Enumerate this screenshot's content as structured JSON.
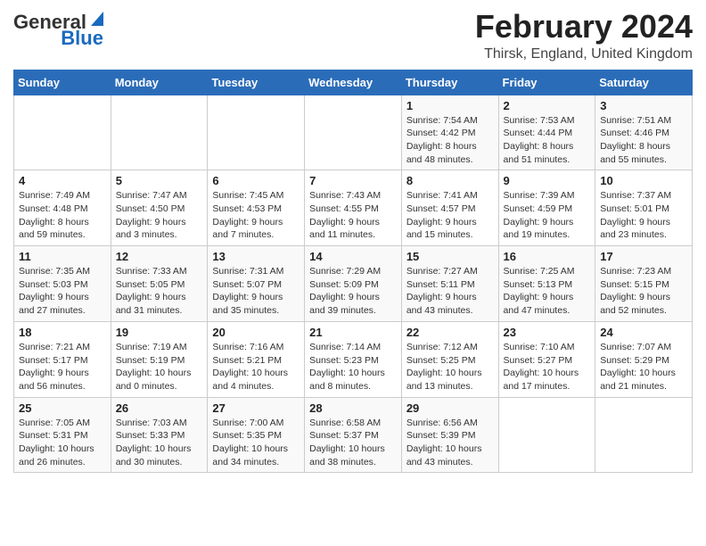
{
  "logo": {
    "line1": "General",
    "line2": "Blue"
  },
  "title": "February 2024",
  "subtitle": "Thirsk, England, United Kingdom",
  "days_of_week": [
    "Sunday",
    "Monday",
    "Tuesday",
    "Wednesday",
    "Thursday",
    "Friday",
    "Saturday"
  ],
  "weeks": [
    [
      {
        "day": "",
        "info": ""
      },
      {
        "day": "",
        "info": ""
      },
      {
        "day": "",
        "info": ""
      },
      {
        "day": "",
        "info": ""
      },
      {
        "day": "1",
        "info": "Sunrise: 7:54 AM\nSunset: 4:42 PM\nDaylight: 8 hours\nand 48 minutes."
      },
      {
        "day": "2",
        "info": "Sunrise: 7:53 AM\nSunset: 4:44 PM\nDaylight: 8 hours\nand 51 minutes."
      },
      {
        "day": "3",
        "info": "Sunrise: 7:51 AM\nSunset: 4:46 PM\nDaylight: 8 hours\nand 55 minutes."
      }
    ],
    [
      {
        "day": "4",
        "info": "Sunrise: 7:49 AM\nSunset: 4:48 PM\nDaylight: 8 hours\nand 59 minutes."
      },
      {
        "day": "5",
        "info": "Sunrise: 7:47 AM\nSunset: 4:50 PM\nDaylight: 9 hours\nand 3 minutes."
      },
      {
        "day": "6",
        "info": "Sunrise: 7:45 AM\nSunset: 4:53 PM\nDaylight: 9 hours\nand 7 minutes."
      },
      {
        "day": "7",
        "info": "Sunrise: 7:43 AM\nSunset: 4:55 PM\nDaylight: 9 hours\nand 11 minutes."
      },
      {
        "day": "8",
        "info": "Sunrise: 7:41 AM\nSunset: 4:57 PM\nDaylight: 9 hours\nand 15 minutes."
      },
      {
        "day": "9",
        "info": "Sunrise: 7:39 AM\nSunset: 4:59 PM\nDaylight: 9 hours\nand 19 minutes."
      },
      {
        "day": "10",
        "info": "Sunrise: 7:37 AM\nSunset: 5:01 PM\nDaylight: 9 hours\nand 23 minutes."
      }
    ],
    [
      {
        "day": "11",
        "info": "Sunrise: 7:35 AM\nSunset: 5:03 PM\nDaylight: 9 hours\nand 27 minutes."
      },
      {
        "day": "12",
        "info": "Sunrise: 7:33 AM\nSunset: 5:05 PM\nDaylight: 9 hours\nand 31 minutes."
      },
      {
        "day": "13",
        "info": "Sunrise: 7:31 AM\nSunset: 5:07 PM\nDaylight: 9 hours\nand 35 minutes."
      },
      {
        "day": "14",
        "info": "Sunrise: 7:29 AM\nSunset: 5:09 PM\nDaylight: 9 hours\nand 39 minutes."
      },
      {
        "day": "15",
        "info": "Sunrise: 7:27 AM\nSunset: 5:11 PM\nDaylight: 9 hours\nand 43 minutes."
      },
      {
        "day": "16",
        "info": "Sunrise: 7:25 AM\nSunset: 5:13 PM\nDaylight: 9 hours\nand 47 minutes."
      },
      {
        "day": "17",
        "info": "Sunrise: 7:23 AM\nSunset: 5:15 PM\nDaylight: 9 hours\nand 52 minutes."
      }
    ],
    [
      {
        "day": "18",
        "info": "Sunrise: 7:21 AM\nSunset: 5:17 PM\nDaylight: 9 hours\nand 56 minutes."
      },
      {
        "day": "19",
        "info": "Sunrise: 7:19 AM\nSunset: 5:19 PM\nDaylight: 10 hours\nand 0 minutes."
      },
      {
        "day": "20",
        "info": "Sunrise: 7:16 AM\nSunset: 5:21 PM\nDaylight: 10 hours\nand 4 minutes."
      },
      {
        "day": "21",
        "info": "Sunrise: 7:14 AM\nSunset: 5:23 PM\nDaylight: 10 hours\nand 8 minutes."
      },
      {
        "day": "22",
        "info": "Sunrise: 7:12 AM\nSunset: 5:25 PM\nDaylight: 10 hours\nand 13 minutes."
      },
      {
        "day": "23",
        "info": "Sunrise: 7:10 AM\nSunset: 5:27 PM\nDaylight: 10 hours\nand 17 minutes."
      },
      {
        "day": "24",
        "info": "Sunrise: 7:07 AM\nSunset: 5:29 PM\nDaylight: 10 hours\nand 21 minutes."
      }
    ],
    [
      {
        "day": "25",
        "info": "Sunrise: 7:05 AM\nSunset: 5:31 PM\nDaylight: 10 hours\nand 26 minutes."
      },
      {
        "day": "26",
        "info": "Sunrise: 7:03 AM\nSunset: 5:33 PM\nDaylight: 10 hours\nand 30 minutes."
      },
      {
        "day": "27",
        "info": "Sunrise: 7:00 AM\nSunset: 5:35 PM\nDaylight: 10 hours\nand 34 minutes."
      },
      {
        "day": "28",
        "info": "Sunrise: 6:58 AM\nSunset: 5:37 PM\nDaylight: 10 hours\nand 38 minutes."
      },
      {
        "day": "29",
        "info": "Sunrise: 6:56 AM\nSunset: 5:39 PM\nDaylight: 10 hours\nand 43 minutes."
      },
      {
        "day": "",
        "info": ""
      },
      {
        "day": "",
        "info": ""
      }
    ]
  ]
}
